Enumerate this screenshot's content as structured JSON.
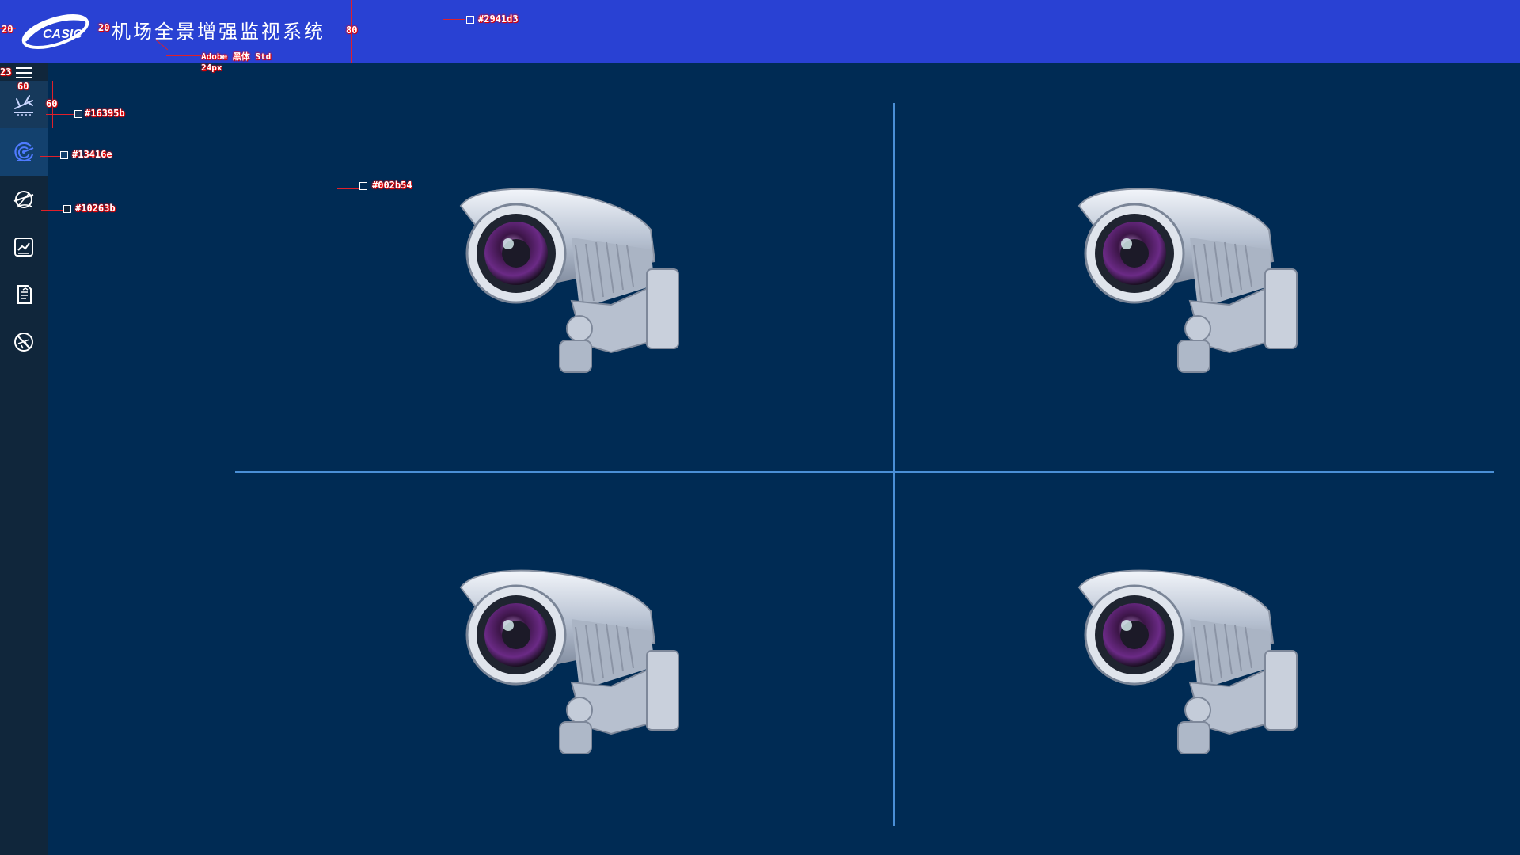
{
  "header": {
    "title": "机场全景增强监视系统",
    "logo": "casic-logo"
  },
  "sidebar": {
    "toggle_icon": "menu-icon",
    "items": [
      {
        "name": "flight-icon",
        "state": "hover"
      },
      {
        "name": "radar-icon",
        "state": "active"
      },
      {
        "name": "globe-plane-icon",
        "state": "normal"
      },
      {
        "name": "chart-icon",
        "state": "normal"
      },
      {
        "name": "document-icon",
        "state": "normal"
      },
      {
        "name": "disabled-plane-icon",
        "state": "normal"
      }
    ]
  },
  "cameras": [
    {
      "name": "camera-1",
      "icon": "cctv-camera-icon"
    },
    {
      "name": "camera-2",
      "icon": "cctv-camera-icon"
    },
    {
      "name": "camera-3",
      "icon": "cctv-camera-icon"
    },
    {
      "name": "camera-4",
      "icon": "cctv-camera-icon"
    }
  ],
  "colors": {
    "header_bg": "#2941d3",
    "sidebar_bg": "#10263b",
    "nav_hover_bg": "#16395b",
    "nav_active_bg": "#13416e",
    "content_bg": "#002b54",
    "grid_line": "#4a8fd6"
  },
  "annotations": {
    "margin_left": "20",
    "logo_gap": "20",
    "header_height": "80",
    "font_name": "Adobe 黑体 Std",
    "font_size": "24px",
    "header_color": "#2941d3",
    "toggle_offset": "23",
    "sidebar_width": "60",
    "item_height": "60",
    "hover_color": "#16395b",
    "active_color": "#13416e",
    "sidebar_color": "#10263b",
    "content_color": "#002b54"
  }
}
